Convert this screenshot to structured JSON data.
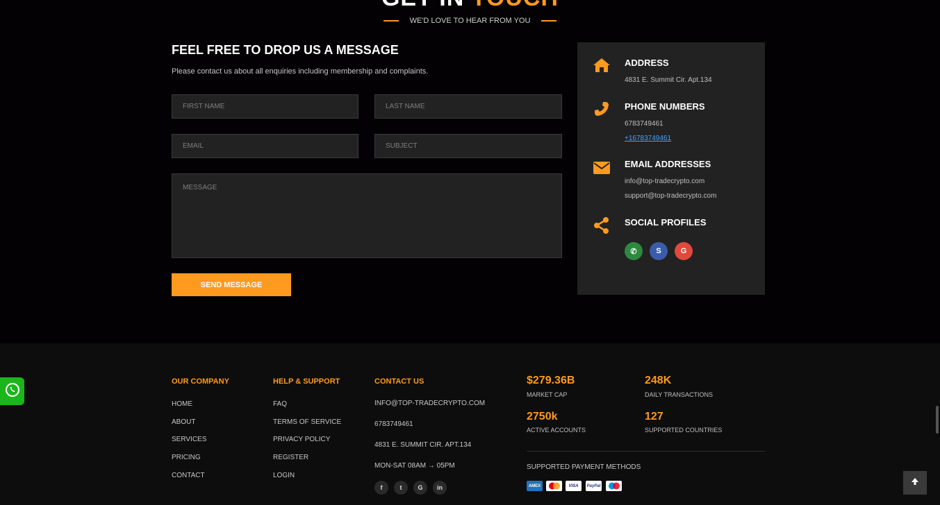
{
  "header": {
    "title_part1": "GET IN",
    "title_part2": "TOUCH",
    "subtitle": "WE'D LOVE TO HEAR FROM YOU"
  },
  "form": {
    "title": "FEEL FREE TO DROP US A MESSAGE",
    "description": "Please contact us about all enquiries including membership and complaints.",
    "first_name_placeholder": "FIRST NAME",
    "last_name_placeholder": "LAST NAME",
    "email_placeholder": "EMAIL",
    "subject_placeholder": "SUBJECT",
    "message_placeholder": "MESSAGE",
    "send_label": "SEND MESSAGE"
  },
  "info": {
    "address_title": "ADDRESS",
    "address_line": "4831 E. Summit Cir. Apt.134",
    "phone_title": "PHONE NUMBERS",
    "phone_1": "6783749461",
    "phone_2": "+16783749461",
    "email_title": "EMAIL ADDRESSES",
    "email_1": "info@top-tradecrypto.com",
    "email_2": "support@top-tradecrypto.com",
    "social_title": "SOCIAL PROFILES",
    "social_icons": [
      "whatsapp-icon",
      "skype-icon",
      "google-plus-icon"
    ]
  },
  "footer": {
    "company": {
      "title": "OUR COMPANY",
      "links": [
        "HOME",
        "ABOUT",
        "SERVICES",
        "PRICING",
        "CONTACT"
      ]
    },
    "help": {
      "title": "HELP & SUPPORT",
      "links": [
        "FAQ",
        "TERMS OF SERVICE",
        "PRIVACY POLICY",
        "REGISTER",
        "LOGIN"
      ]
    },
    "contact": {
      "title": "CONTACT US",
      "email": "INFO@TOP-TRADECRYPTO.COM",
      "phone": "6783749461",
      "address": "4831 E. SUMMIT CIR. APT.134",
      "hours": "MON-SAT 08AM → 05PM",
      "social_icons": [
        "facebook-icon",
        "twitter-icon",
        "google-icon",
        "linkedin-icon"
      ]
    },
    "stats": [
      {
        "value": "$279.36B",
        "label": "MARKET CAP"
      },
      {
        "value": "248K",
        "label": "DAILY TRANSACTIONS"
      },
      {
        "value": "2750k",
        "label": "ACTIVE ACCOUNTS"
      },
      {
        "value": "127",
        "label": "SUPPORTED COUNTRIES"
      }
    ],
    "payment_title": "SUPPORTED PAYMENT METHODS",
    "payment_icons": [
      "amex-icon",
      "mastercard-icon",
      "visa-icon",
      "paypal-icon",
      "maestro-icon"
    ]
  },
  "colors": {
    "accent": "#ff9a1e",
    "background": "#030103",
    "card": "#222222",
    "chat_widget": "#1cb51c"
  }
}
